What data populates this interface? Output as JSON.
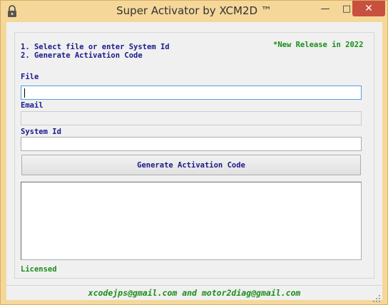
{
  "window": {
    "title": "Super Activator by XCM2D ™",
    "minimize": "—",
    "maximize": "□",
    "close": "✕"
  },
  "instructions": {
    "step1": "1. Select file or enter System Id",
    "step2": "2. Generate Activation Code",
    "release_note": "*New Release in 2022"
  },
  "form": {
    "file_label": "File",
    "file_value": "",
    "email_label": "Email",
    "email_value": "",
    "system_id_label": "System Id",
    "system_id_value": "",
    "generate_button": "Generate Activation Code",
    "output_value": ""
  },
  "status": {
    "license": "Licensed",
    "contact": "xcodejps@gmail.com and motor2diag@gmail.com"
  },
  "icons": {
    "app": "lock-icon",
    "grip": "resize-grip-icon"
  },
  "colors": {
    "titlebar": "#f5d79a",
    "close_button": "#c7503f",
    "instruction_text": "#1a1a8c",
    "highlight_text": "#1a8c1a"
  }
}
